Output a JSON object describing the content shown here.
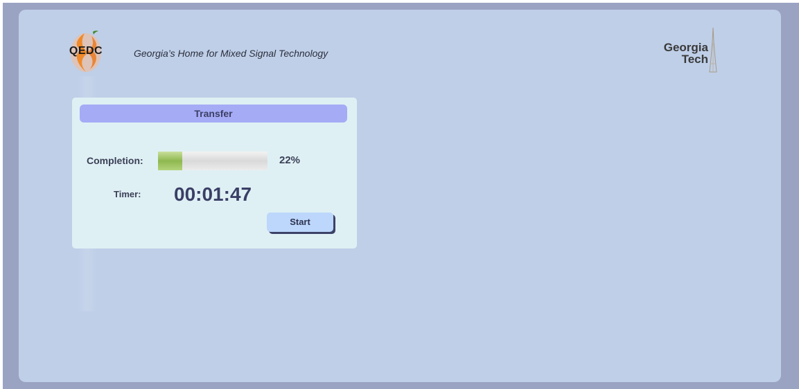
{
  "header": {
    "logo_text": "QEDC",
    "tagline": "Georgia’s Home for Mixed Signal Technology",
    "partner_logo_line1": "Georgia",
    "partner_logo_line2": "Tech"
  },
  "panel": {
    "title": "Transfer",
    "completion_label": "Completion:",
    "completion_percent": 22,
    "completion_text": "22%",
    "timer_label": "Timer:",
    "timer_value": "00:01:47",
    "start_button_label": "Start"
  },
  "colors": {
    "frame": "#9ba3c2",
    "background": "#bfcfe8",
    "panel": "#dff0f4",
    "title_bar": "#a6abf6",
    "progress_fill": "#8fb850",
    "button": "#bcd7fb"
  }
}
